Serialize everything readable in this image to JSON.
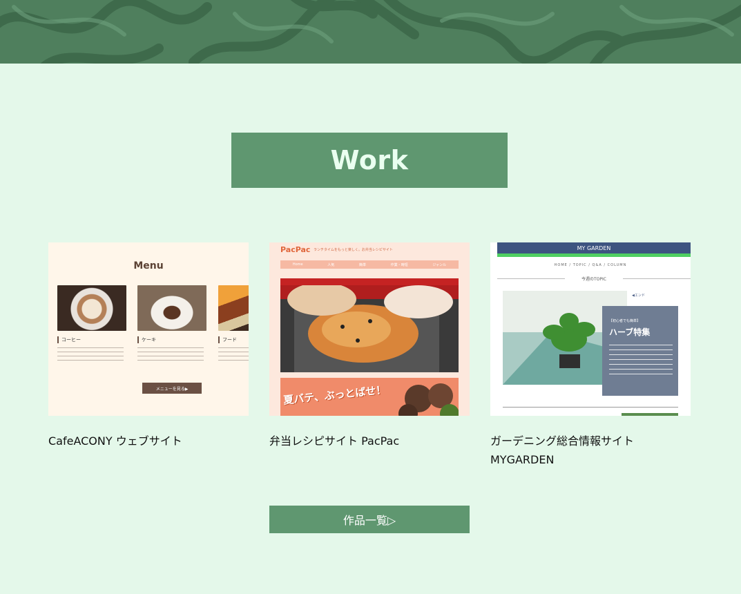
{
  "section": {
    "title": "Work"
  },
  "works": [
    {
      "caption": "CafeACONY ウェブサイト",
      "thumb": {
        "menu_title": "Menu",
        "items": [
          {
            "name": "コーヒー"
          },
          {
            "name": "ケーキ"
          },
          {
            "name": "フード"
          }
        ],
        "button": "メニューを見る▶"
      }
    },
    {
      "caption": "弁当レシピサイト PacPac",
      "thumb": {
        "logo": "PacPac",
        "tagline": "ランチタイムをもっと楽しく。お弁当レシピサイト",
        "nav": [
          "Home",
          "人気",
          "簡単",
          "作業・時短",
          "ジャンル"
        ],
        "banner_text": "夏バテ、ぶっとばせ！"
      }
    },
    {
      "caption": "ガーデニング総合情報サイト MYGARDEN",
      "thumb": {
        "site_title": "MY GARDEN",
        "nav": "HOME / TOPIC / Q&A / COLUMN",
        "topic_heading": "今週のTOPIC",
        "new_label": "◀エンド",
        "panel_small": "【初心者でも簡単】",
        "panel_title": "ハーブ特集"
      }
    }
  ],
  "more_button": "作品一覧▷",
  "colors": {
    "background": "#e4f8ea",
    "accent": "#5f9770",
    "banner": "#4d7d5c"
  }
}
